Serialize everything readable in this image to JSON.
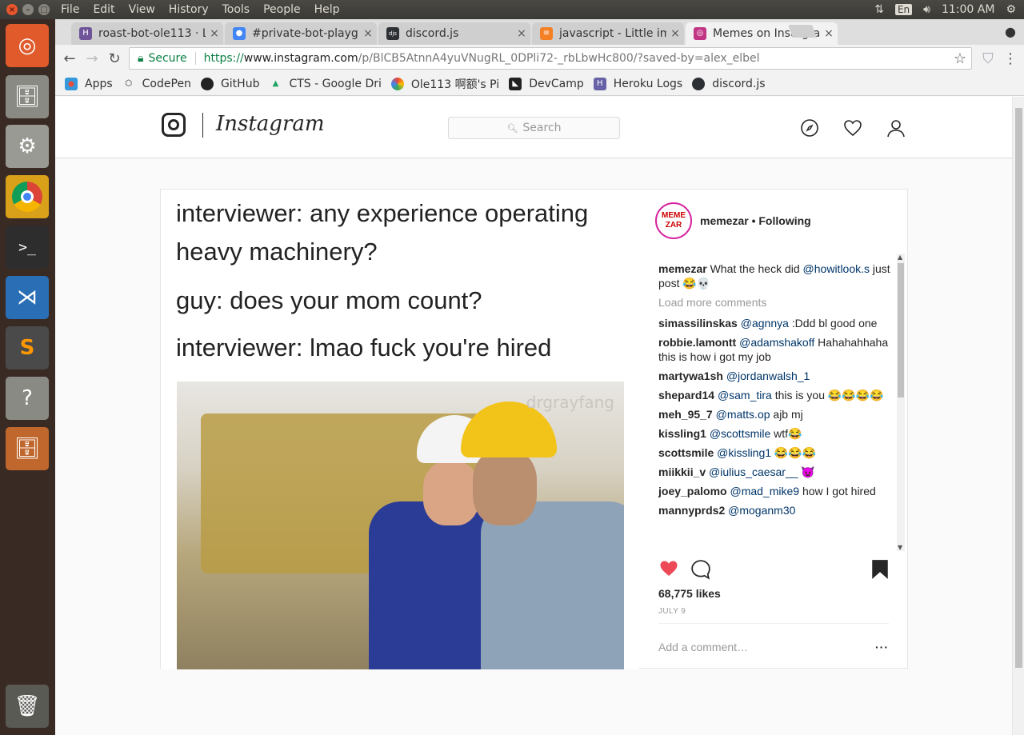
{
  "system": {
    "menus": [
      "File",
      "Edit",
      "View",
      "History",
      "Tools",
      "People",
      "Help"
    ],
    "lang": "En",
    "time": "11:00 AM"
  },
  "tabs": [
    {
      "label": "roast-bot-ole113 · L",
      "fav_color": "#6f5499",
      "fav_glyph": "H"
    },
    {
      "label": "#private-bot-playgr",
      "fav_color": "#4285f4",
      "fav_glyph": "●"
    },
    {
      "label": "discord.js",
      "fav_color": "#2c2f33",
      "fav_glyph": "djs"
    },
    {
      "label": "javascript - Little im",
      "fav_color": "#f48024",
      "fav_glyph": "≡"
    },
    {
      "label": "Memes on Instagram",
      "fav_color": "#c13584",
      "fav_glyph": "◎"
    }
  ],
  "address": {
    "secure_label": "Secure",
    "proto": "https://",
    "host": "www.instagram.com",
    "path": "/p/BlCB5AtnnA4yuVNugRL_0DPli72-_rbLbwHc800/?saved-by=alex_elbel"
  },
  "bookmarks": [
    {
      "label": "Apps",
      "color": "#e74c3c"
    },
    {
      "label": "CodePen",
      "color": "#222"
    },
    {
      "label": "GitHub",
      "color": "#222"
    },
    {
      "label": "CTS - Google Dri",
      "color": "#1fa463"
    },
    {
      "label": "Ole113 啊额's Pi",
      "color": "#ea4335"
    },
    {
      "label": "DevCamp",
      "color": "#222"
    },
    {
      "label": "Heroku Logs",
      "color": "#6762a6"
    },
    {
      "label": "discord.js",
      "color": "#2c2f33"
    }
  ],
  "instagram": {
    "wordmark": "Instagram",
    "search_placeholder": "Search"
  },
  "meme": {
    "lines": [
      "interviewer: any experience operating",
      "heavy machinery?",
      "guy: does your mom count?",
      "interviewer: lmao fuck you're hired"
    ],
    "watermark": "drgrayfang"
  },
  "post": {
    "avatar_text": "MEME ZAR",
    "username": "memezar",
    "follow_status": "• Following",
    "caption_user": "memezar",
    "caption_pre": "What the heck did ",
    "caption_mention": "@howitlook.s",
    "caption_post": " just post 😂💀",
    "load_more": "Load more comments",
    "comments": [
      {
        "user": "simassilinskas",
        "mention": "@agnnya",
        "text": " :Ddd bl good one"
      },
      {
        "user": "robbie.lamontt",
        "mention": "@adamshakoff",
        "text": " Hahahahhaha this is how i got my job"
      },
      {
        "user": "martywa1sh",
        "mention": "@jordanwalsh_1",
        "text": ""
      },
      {
        "user": "shepard14",
        "mention": "@sam_tira",
        "text": " this is you 😂😂😂😂"
      },
      {
        "user": "meh_95_7",
        "mention": "@matts.op",
        "text": " ajb mj"
      },
      {
        "user": "kissling1",
        "mention": "@scottsmile",
        "text": " wtf😂"
      },
      {
        "user": "scottsmile",
        "mention": "@kissling1",
        "text": " 😂😂😂"
      },
      {
        "user": "miikkii_v",
        "mention": "@iulius_caesar__",
        "text": " 😈"
      },
      {
        "user": "joey_palomo",
        "mention": "@mad_mike9",
        "text": " how I got hired"
      },
      {
        "user": "mannyprds2",
        "mention": "@moganm30",
        "text": ""
      }
    ],
    "likes": "68,775 likes",
    "date": "JULY 9",
    "add_comment_placeholder": "Add a comment…",
    "more": "···",
    "liked_color": "#ed4956"
  }
}
